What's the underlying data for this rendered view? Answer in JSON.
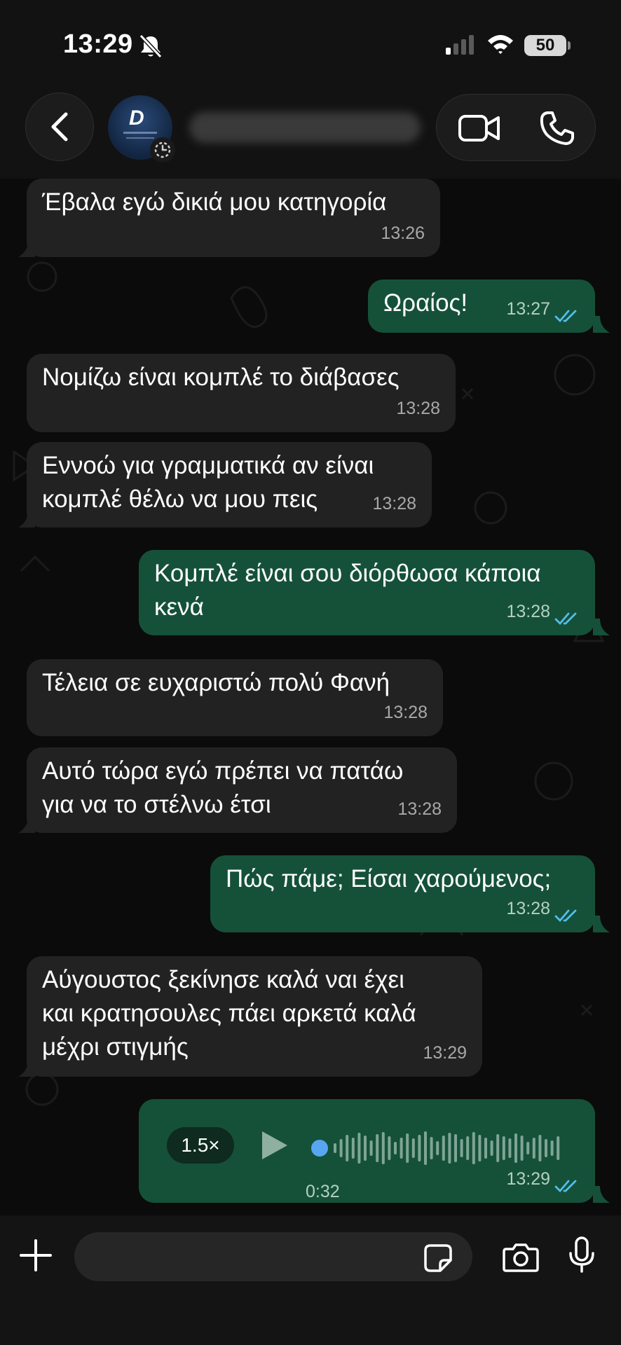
{
  "status_bar": {
    "time": "13:29",
    "battery": "50"
  },
  "header": {
    "contact_name": "",
    "avatar_letter": "D"
  },
  "colors": {
    "incoming_bubble": "#222222",
    "outgoing_bubble": "#155139",
    "read_ticks": "#53bdeb",
    "voice_dot": "#58a6f0"
  },
  "messages": [
    {
      "direction": "in",
      "text": "Έβαλα εγώ δικιά μου κατηγορία",
      "time": "13:26"
    },
    {
      "direction": "out",
      "text": "Ωραίος!",
      "time": "13:27",
      "status": "read"
    },
    {
      "direction": "in",
      "text": "Νομίζω είναι κομπλέ το διάβασες",
      "time": "13:28"
    },
    {
      "direction": "in",
      "text": "Εννοώ για γραμματικά αν είναι\nκομπλέ θέλω να μου πεις",
      "time": "13:28"
    },
    {
      "direction": "out",
      "text": "Κομπλέ είναι σου διόρθωσα κάποια\nκενά",
      "time": "13:28",
      "status": "read"
    },
    {
      "direction": "in",
      "text": "Τέλεια σε ευχαριστώ πολύ Φανή",
      "time": "13:28"
    },
    {
      "direction": "in",
      "text": "Αυτό τώρα εγώ πρέπει να πατάω\nγια να το στέλνω έτσι",
      "time": "13:28"
    },
    {
      "direction": "out",
      "text": "Πώς πάμε; Είσαι χαρούμενος;",
      "time": "13:28",
      "status": "read"
    },
    {
      "direction": "in",
      "text": "Αύγουστος ξεκίνησε καλά ναι έχει\nκαι κρατησουλες πάει αρκετά καλά\nμέχρι στιγμής",
      "time": "13:29"
    }
  ],
  "voice_note": {
    "speed": "1.5×",
    "duration": "0:32",
    "time": "13:29",
    "status": "read",
    "progress": 0
  },
  "input": {
    "placeholder": ""
  }
}
